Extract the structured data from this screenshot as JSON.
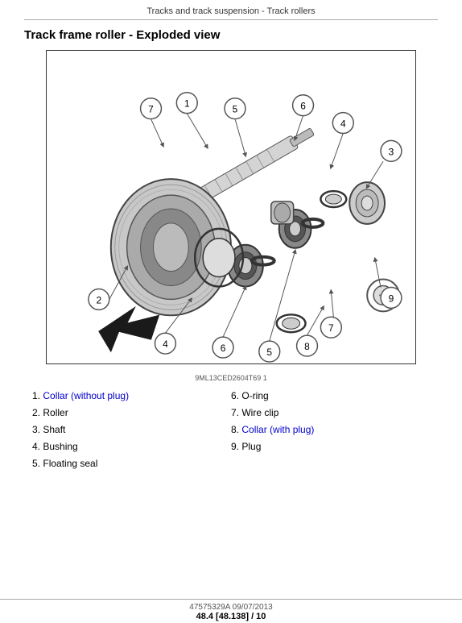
{
  "header": {
    "title": "Tracks and track suspension - Track rollers"
  },
  "section": {
    "title": "Track frame roller - Exploded view"
  },
  "diagram": {
    "caption": "9ML13CED2604T69    1"
  },
  "parts": {
    "left_column": [
      {
        "num": "1.",
        "name": "Collar (without plug)",
        "blue": true
      },
      {
        "num": "2.",
        "name": "Roller",
        "blue": false
      },
      {
        "num": "3.",
        "name": "Shaft",
        "blue": false
      },
      {
        "num": "4.",
        "name": "Bushing",
        "blue": false
      },
      {
        "num": "5.",
        "name": "Floating seal",
        "blue": false
      }
    ],
    "right_column": [
      {
        "num": "6.",
        "name": "O-ring",
        "blue": false
      },
      {
        "num": "7.",
        "name": "Wire clip",
        "blue": false
      },
      {
        "num": "8.",
        "name": "Collar (with plug)",
        "blue": true
      },
      {
        "num": "9.",
        "name": "Plug",
        "blue": false
      }
    ]
  },
  "footer": {
    "doc_number": "47575329A 09/07/2013",
    "page": "48.4 [48.138] / 10"
  }
}
